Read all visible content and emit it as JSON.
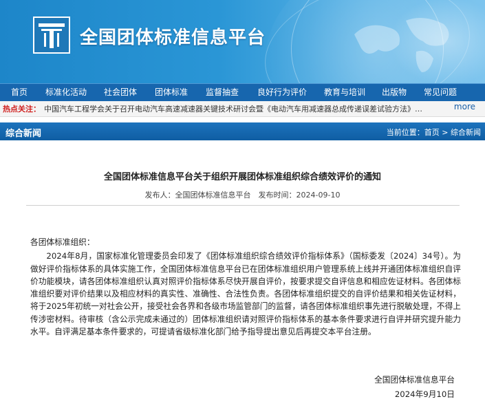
{
  "site": {
    "title": "全国团体标准信息平台"
  },
  "nav": {
    "items": [
      "首页",
      "标准化活动",
      "社会团体",
      "团体标准",
      "监督抽查",
      "良好行为评价",
      "教育与培训",
      "出版物",
      "常见问题"
    ]
  },
  "hotbar": {
    "label": "热点关注：",
    "text": "中国汽车工程学会关于召开电动汽车高速减速器关键技术研讨会暨《电动汽车用减速器总成传递误差试验方法》团标启动会的...",
    "more": "more"
  },
  "section": {
    "title": "综合新闻",
    "breadcrumb_prefix": "当前位置：",
    "breadcrumb_home": "首页",
    "breadcrumb_sep": " > ",
    "breadcrumb_current": "综合新闻"
  },
  "article": {
    "title": "全国团体标准信息平台关于组织开展团体标准组织综合绩效评价的通知",
    "meta": "发布人：全国团体标准信息平台　发布时间：2024-09-10",
    "salutation": "各团体标准组织：",
    "paragraph": "2024年8月，国家标准化管理委员会印发了《团体标准组织综合绩效评价指标体系》（国标委发〔2024〕34号）。为做好评价指标体系的具体实施工作，全国团体标准信息平台已在团体标准组织用户管理系统上线并开通团体标准组织自评价功能模块，请各团体标准组织认真对照评价指标体系尽快开展自评价，按要求提交自评信息和相应佐证材料。各团体标准组织要对评价结果以及相应材料的真实性、准确性、合法性负责。各团体标准组织提交的自评价结果和相关佐证材料，将于2025年初统一对社会公开，接受社会各界和各级市场监管部门的监督，请各团体标准组织事先进行脱敏处理，不得上传涉密材料。待审核（含公示完成未通过的）团体标准组织请对照评价指标体系的基本条件要求进行自评并研究提升能力水平。自评满足基本条件要求的，可提请省级标准化部门给予指导提出意见后再提交本平台注册。",
    "sign_org": "全国团体标准信息平台",
    "sign_date": "2024年9月10日"
  },
  "colors": {
    "banner": "#2a96d6",
    "nav": "#1766ae",
    "hot_label": "#d0201f",
    "section_bar": "#1466b0"
  }
}
